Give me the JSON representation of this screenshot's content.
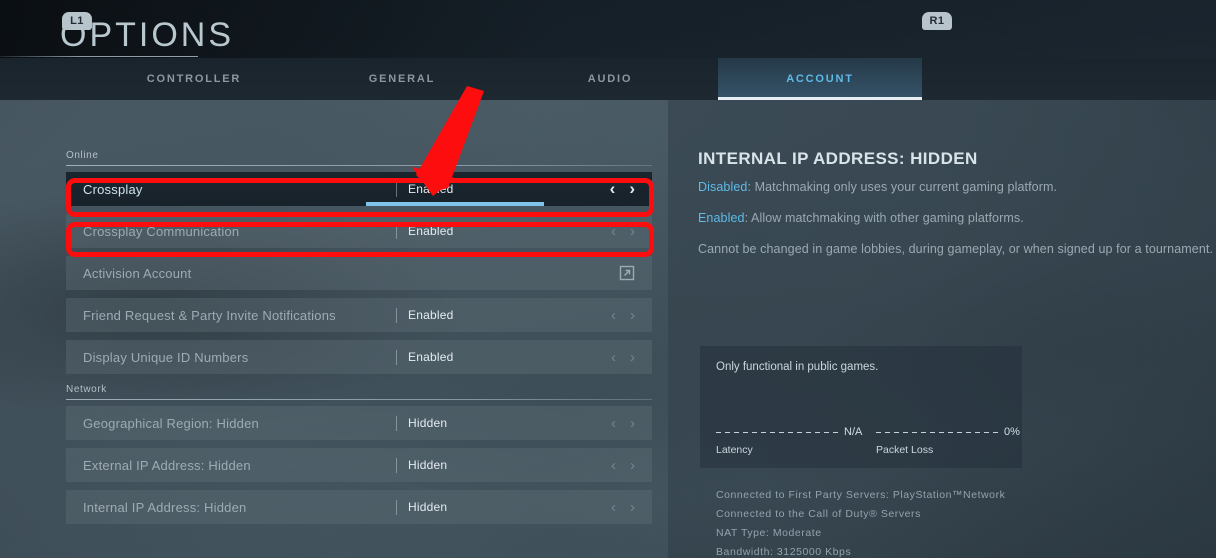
{
  "header": {
    "title": "OPTIONS"
  },
  "tabs": {
    "left_shoulder": "L1",
    "right_shoulder": "R1",
    "items": [
      {
        "id": "controller",
        "label": "CONTROLLER",
        "active": false
      },
      {
        "id": "general",
        "label": "GENERAL",
        "active": false
      },
      {
        "id": "audio",
        "label": "AUDIO",
        "active": false
      },
      {
        "id": "account",
        "label": "ACCOUNT",
        "active": true
      }
    ]
  },
  "settings": {
    "sections": [
      {
        "id": "online",
        "heading": "Online",
        "rows": [
          {
            "id": "crossplay",
            "label": "Crossplay",
            "value": "Enabled",
            "control": "stepper",
            "selected": true
          },
          {
            "id": "crossplay-communication",
            "label": "Crossplay Communication",
            "value": "Enabled",
            "control": "stepper",
            "selected": false
          },
          {
            "id": "activision-account",
            "label": "Activision Account",
            "value": "",
            "control": "external-link",
            "selected": false
          },
          {
            "id": "friend-request-notifications",
            "label": "Friend Request & Party Invite Notifications",
            "value": "Enabled",
            "control": "stepper",
            "selected": false
          },
          {
            "id": "display-unique-id-numbers",
            "label": "Display Unique ID Numbers",
            "value": "Enabled",
            "control": "stepper",
            "selected": false
          }
        ]
      },
      {
        "id": "network",
        "heading": "Network",
        "rows": [
          {
            "id": "geographical-region",
            "label": "Geographical Region: Hidden",
            "value": "Hidden",
            "control": "stepper",
            "selected": false
          },
          {
            "id": "external-ip-address",
            "label": "External IP Address: Hidden",
            "value": "Hidden",
            "control": "stepper",
            "selected": false
          },
          {
            "id": "internal-ip-address",
            "label": "Internal IP Address: Hidden",
            "value": "Hidden",
            "control": "stepper",
            "selected": false
          }
        ]
      }
    ],
    "arrow_left": "‹",
    "arrow_right": "›"
  },
  "detail": {
    "title": "INTERNAL IP ADDRESS: HIDDEN",
    "disabled_keyword": "Disabled",
    "disabled_text": ": Matchmaking only uses your current gaming platform.",
    "enabled_keyword": "Enabled",
    "enabled_text": ": Allow matchmaking with other gaming platforms.",
    "note": "Cannot be changed in game lobbies, during gameplay, or when signed up for a tournament."
  },
  "network_card": {
    "note": "Only functional in public games.",
    "meters": [
      {
        "id": "latency",
        "name": "Latency",
        "value": "N/A"
      },
      {
        "id": "packet-loss",
        "name": "Packet Loss",
        "value": "0%"
      }
    ]
  },
  "connection_status": {
    "lines": [
      "Connected to First Party Servers: PlayStation™Network",
      "Connected to the Call of Duty® Servers",
      "NAT Type: Moderate",
      "Bandwidth: 3125000 Kbps"
    ]
  },
  "annotations": {
    "highlight_color": "#fd0d0d",
    "boxes": [
      {
        "id": "crossplay",
        "target": "Crossplay"
      },
      {
        "id": "crossplay-communication",
        "target": "Crossplay Communication"
      }
    ],
    "arrow": {
      "id": "pointer-arrow",
      "points_to": "Crossplay"
    }
  }
}
